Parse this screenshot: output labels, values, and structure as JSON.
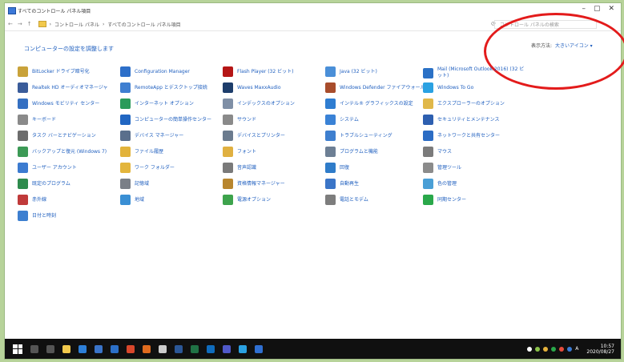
{
  "window": {
    "title": "すべてのコントロール パネル項目"
  },
  "address": {
    "parts": [
      "コントロール パネル",
      "すべてのコントロール パネル項目"
    ],
    "search_placeholder": "コントロール パネルの検索"
  },
  "main": {
    "heading": "コンピューターの設定を調整します",
    "view_by_label": "表示方法:",
    "view_by_value": "大きいアイコン ▾"
  },
  "items": [
    {
      "label": "BitLocker ドライブ暗号化",
      "icon": "bitlocker-icon",
      "color": "#c9a23a"
    },
    {
      "label": "Configuration Manager",
      "icon": "configuration-manager-icon",
      "color": "#2d6fc9"
    },
    {
      "label": "Flash Player (32 ビット)",
      "icon": "flash-player-icon",
      "color": "#b51616"
    },
    {
      "label": "Java (32 ビット)",
      "icon": "java-icon",
      "color": "#4a8fd8"
    },
    {
      "label": "Mail (Microsoft Outlook 2016) (32 ビット)",
      "icon": "mail-icon",
      "color": "#2b71c6"
    },
    {
      "label": "Realtek HD オーディオマネージャ",
      "icon": "realtek-icon",
      "color": "#3a5c9a"
    },
    {
      "label": "RemoteApp とデスクトップ接続",
      "icon": "remoteapp-icon",
      "color": "#3f7fd1"
    },
    {
      "label": "Waves MaxxAudio",
      "icon": "waves-icon",
      "color": "#1d3d6b"
    },
    {
      "label": "Windows Defender ファイアウォール",
      "icon": "firewall-icon",
      "color": "#a84d2c"
    },
    {
      "label": "Windows To Go",
      "icon": "windows-to-go-icon",
      "color": "#2aa1e2"
    },
    {
      "label": "Windows モビリティ センター",
      "icon": "mobility-center-icon",
      "color": "#3570c2"
    },
    {
      "label": "インターネット オプション",
      "icon": "internet-options-icon",
      "color": "#2a9b5a"
    },
    {
      "label": "インデックスのオプション",
      "icon": "indexing-icon",
      "color": "#7f8fa6"
    },
    {
      "label": "インテル® グラフィックスの設定",
      "icon": "intel-graphics-icon",
      "color": "#2f7dd1"
    },
    {
      "label": "エクスプローラーのオプション",
      "icon": "explorer-options-icon",
      "color": "#e0b84a"
    },
    {
      "label": "キーボード",
      "icon": "keyboard-icon",
      "color": "#8a8a8a"
    },
    {
      "label": "コンピューターの簡単操作センター",
      "icon": "ease-of-access-icon",
      "color": "#2166c2"
    },
    {
      "label": "サウンド",
      "icon": "sound-icon",
      "color": "#8a8a8a"
    },
    {
      "label": "システム",
      "icon": "system-icon",
      "color": "#3a82d6"
    },
    {
      "label": "セキュリティとメンテナンス",
      "icon": "security-maintenance-icon",
      "color": "#2d5fb0"
    },
    {
      "label": "タスク バーとナビゲーション",
      "icon": "taskbar-icon",
      "color": "#6c6c6c"
    },
    {
      "label": "デバイス マネージャー",
      "icon": "device-manager-icon",
      "color": "#5a6f8c"
    },
    {
      "label": "デバイスとプリンター",
      "icon": "devices-printers-icon",
      "color": "#6b7b8e"
    },
    {
      "label": "トラブルシューティング",
      "icon": "troubleshooting-icon",
      "color": "#3e7fcf"
    },
    {
      "label": "ネットワークと共有センター",
      "icon": "network-sharing-icon",
      "color": "#2b6cc4"
    },
    {
      "label": "バックアップと復元 (Windows 7)",
      "icon": "backup-restore-icon",
      "color": "#3c9a56"
    },
    {
      "label": "ファイル履歴",
      "icon": "file-history-icon",
      "color": "#e2b33b"
    },
    {
      "label": "フォント",
      "icon": "fonts-icon",
      "color": "#e0b040"
    },
    {
      "label": "プログラムと機能",
      "icon": "programs-features-icon",
      "color": "#6d7f94"
    },
    {
      "label": "マウス",
      "icon": "mouse-icon",
      "color": "#7b7b7b"
    },
    {
      "label": "ユーザー アカウント",
      "icon": "user-accounts-icon",
      "color": "#3c7bd0"
    },
    {
      "label": "ワーク フォルダー",
      "icon": "work-folders-icon",
      "color": "#e3b53c"
    },
    {
      "label": "音声認識",
      "icon": "speech-recognition-icon",
      "color": "#7a7a7a"
    },
    {
      "label": "回復",
      "icon": "recovery-icon",
      "color": "#2f7cc9"
    },
    {
      "label": "管理ツール",
      "icon": "admin-tools-icon",
      "color": "#8b8b8b"
    },
    {
      "label": "既定のプログラム",
      "icon": "default-programs-icon",
      "color": "#2e8b4d"
    },
    {
      "label": "記憶域",
      "icon": "storage-spaces-icon",
      "color": "#7a7f87"
    },
    {
      "label": "資格情報マネージャー",
      "icon": "credential-manager-icon",
      "color": "#b8862e"
    },
    {
      "label": "自動再生",
      "icon": "autoplay-icon",
      "color": "#3b75c7"
    },
    {
      "label": "色の管理",
      "icon": "color-management-icon",
      "color": "#4a9fd6"
    },
    {
      "label": "赤外線",
      "icon": "infrared-icon",
      "color": "#c03a3a"
    },
    {
      "label": "地域",
      "icon": "region-icon",
      "color": "#3a8fd4"
    },
    {
      "label": "電源オプション",
      "icon": "power-options-icon",
      "color": "#3da34c"
    },
    {
      "label": "電話とモデム",
      "icon": "phone-modem-icon",
      "color": "#7d7d7d"
    },
    {
      "label": "同期センター",
      "icon": "sync-center-icon",
      "color": "#2aa84a"
    },
    {
      "label": "日付と時刻",
      "icon": "date-time-icon",
      "color": "#3d7fd0"
    }
  ],
  "taskbar": {
    "icons": [
      {
        "icon": "search-icon",
        "color": "#555555"
      },
      {
        "icon": "task-view-icon",
        "color": "#555555"
      },
      {
        "icon": "explorer-icon",
        "color": "#f2c94c"
      },
      {
        "icon": "edge-icon",
        "color": "#2d7fd8"
      },
      {
        "icon": "store-icon",
        "color": "#3a74c9"
      },
      {
        "icon": "mail-app-icon",
        "color": "#2b6fc7"
      },
      {
        "icon": "chrome-icon",
        "color": "#d9472b"
      },
      {
        "icon": "firefox-icon",
        "color": "#e06b1e"
      },
      {
        "icon": "calculator-icon",
        "color": "#cccccc"
      },
      {
        "icon": "word-icon",
        "color": "#2b5797"
      },
      {
        "icon": "excel-icon",
        "color": "#207245"
      },
      {
        "icon": "outlook-icon",
        "color": "#0f6cbd"
      },
      {
        "icon": "teams-icon",
        "color": "#5059c9"
      },
      {
        "icon": "app-icon",
        "color": "#2aa1e2"
      },
      {
        "icon": "control-panel-taskbar-icon",
        "color": "#2f6fd1"
      }
    ],
    "tray_colors": [
      "#3a7bd5",
      "#e64c3c",
      "#2aa84a",
      "#e6b23c",
      "#8bc34a",
      "#ffffff"
    ],
    "ime": "A",
    "time": "10:57",
    "date": "2020/08/27"
  }
}
